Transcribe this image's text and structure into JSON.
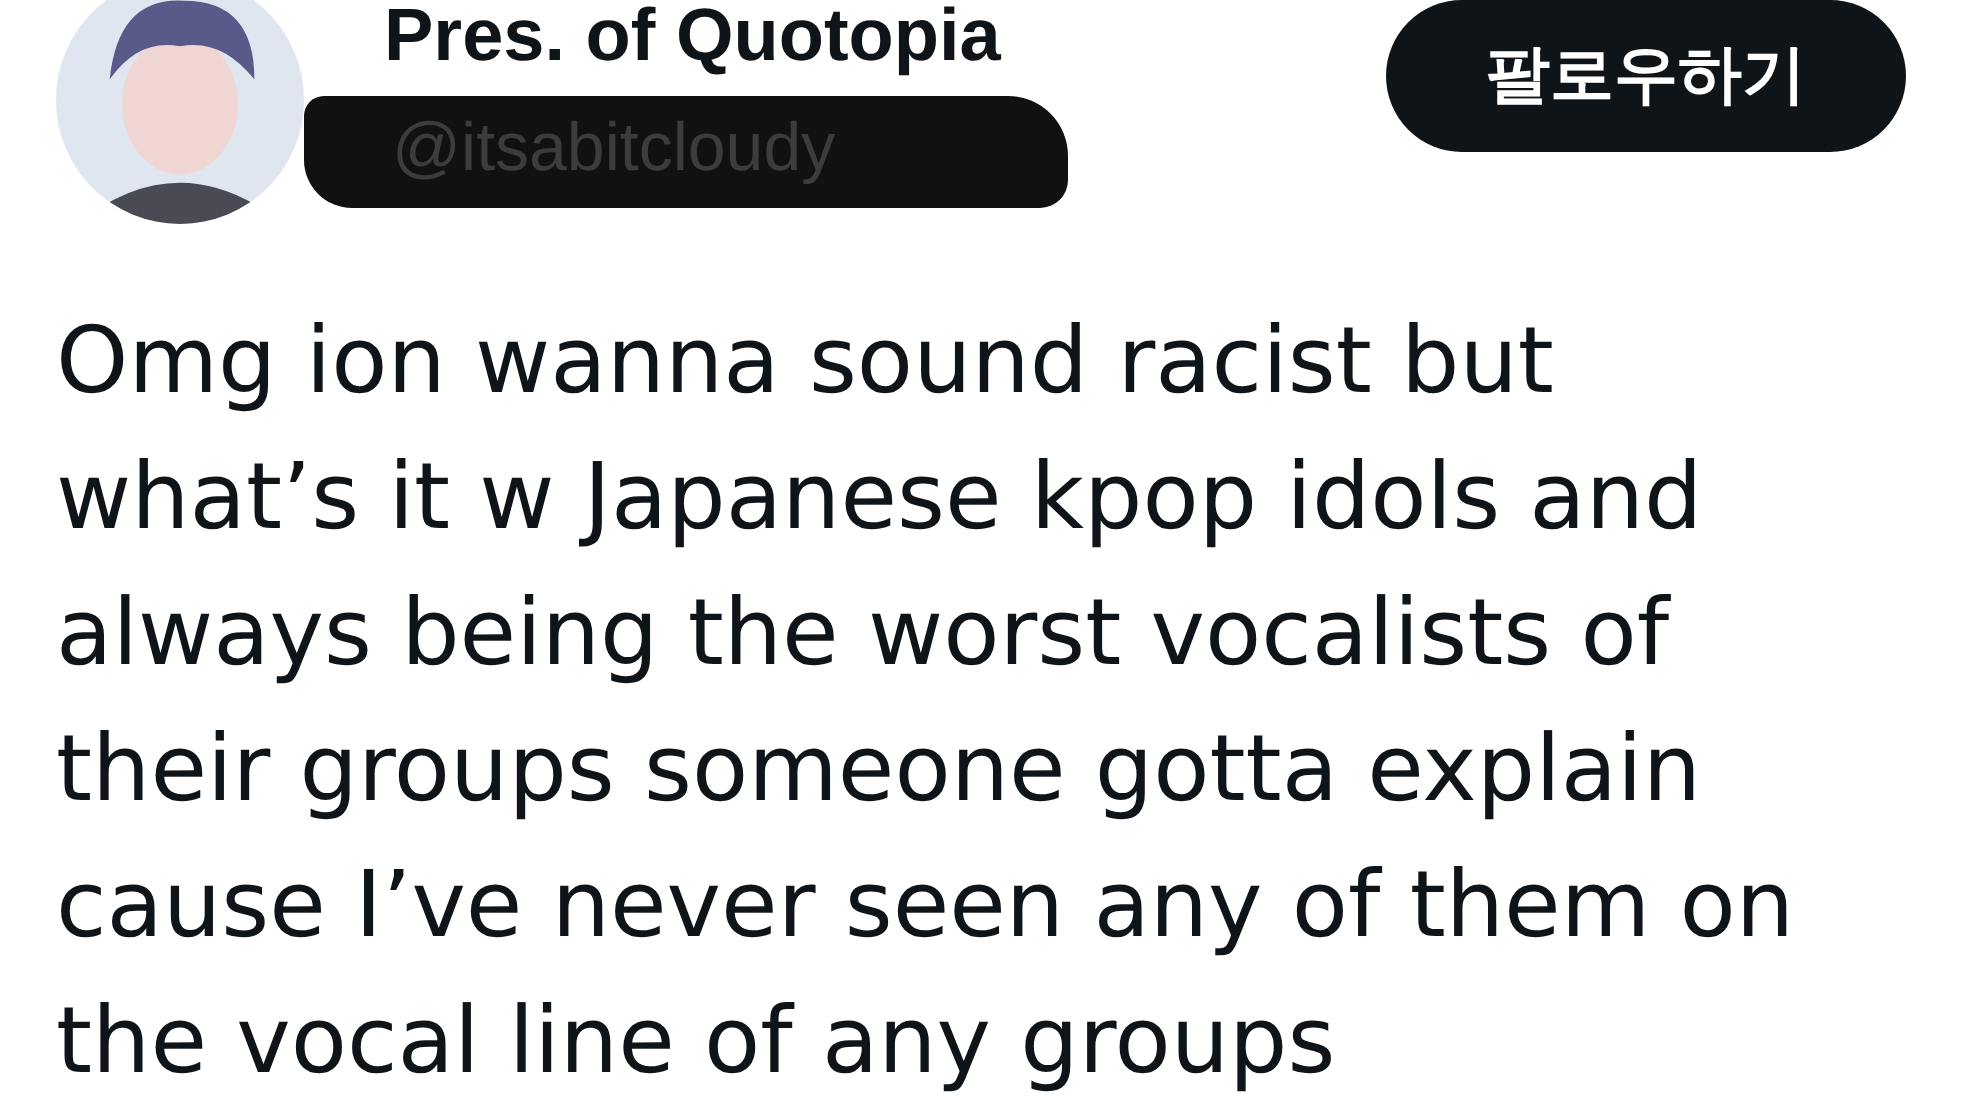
{
  "author": {
    "name": "Pres. of Quotopia",
    "handle": "@itsabitcloudy",
    "handle_redacted": true
  },
  "follow_button": {
    "label": "팔로우하기"
  },
  "post": {
    "lines": [
      "Omg ion wanna sound racist but",
      "what’s it w Japanese kpop idols and",
      "always being the worst vocalists of",
      "their groups someone gotta explain",
      "cause I’ve never seen any of them on",
      "the vocal line of any groups"
    ]
  }
}
